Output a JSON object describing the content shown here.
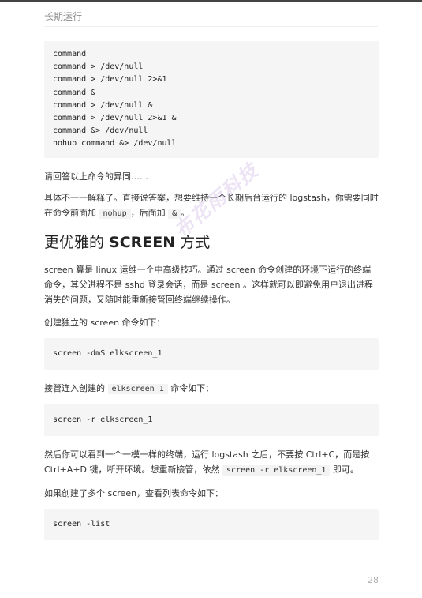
{
  "header": {
    "title": "长期运行"
  },
  "code_block_1": {
    "lines": [
      "command",
      "command > /dev/null",
      "command > /dev/null 2>&1",
      "command &",
      "command > /dev/null &",
      "command > /dev/null 2>&1 &",
      "command &> /dev/null",
      "nohup command &> /dev/null"
    ]
  },
  "para_question": "请回答以上命令的异同……",
  "para_answer": {
    "before": "具体不一一解释了。直接说答案，想要维持一个长期后台运行的 logstash，你需要同时在命令前面加 ",
    "code1": "nohup",
    "middle": "，后面加 ",
    "code2": "&",
    "after": "。"
  },
  "heading": {
    "prefix": "更优雅的 ",
    "keyword": "SCREEN",
    "suffix": " 方式"
  },
  "para_screen_intro": "screen 算是 linux 运维一个中高级技巧。通过 screen 命令创建的环境下运行的终端命令，其父进程不是 sshd 登录会话，而是 screen 。这样就可以即避免用户退出进程消失的问题，又随时能重新接管回终端继续操作。",
  "para_create": "创建独立的 screen 命令如下：",
  "code_create": "screen -dmS elkscreen_1",
  "para_attach": {
    "before": "接管连入创建的 ",
    "code": "elkscreen_1",
    "after": " 命令如下："
  },
  "code_attach": "screen -r elkscreen_1",
  "para_detach": {
    "before": "然后你可以看到一个一模一样的终端，运行 logstash 之后，不要按 Ctrl+C，而是按 Ctrl+A+D 键，断开环境。想重新接管，依然 ",
    "code": "screen -r elkscreen_1",
    "after": " 即可。"
  },
  "para_list": "如果创建了多个 screen，查看列表命令如下：",
  "code_list": "screen -list",
  "watermark": "布花雨科技",
  "page_number": "28"
}
